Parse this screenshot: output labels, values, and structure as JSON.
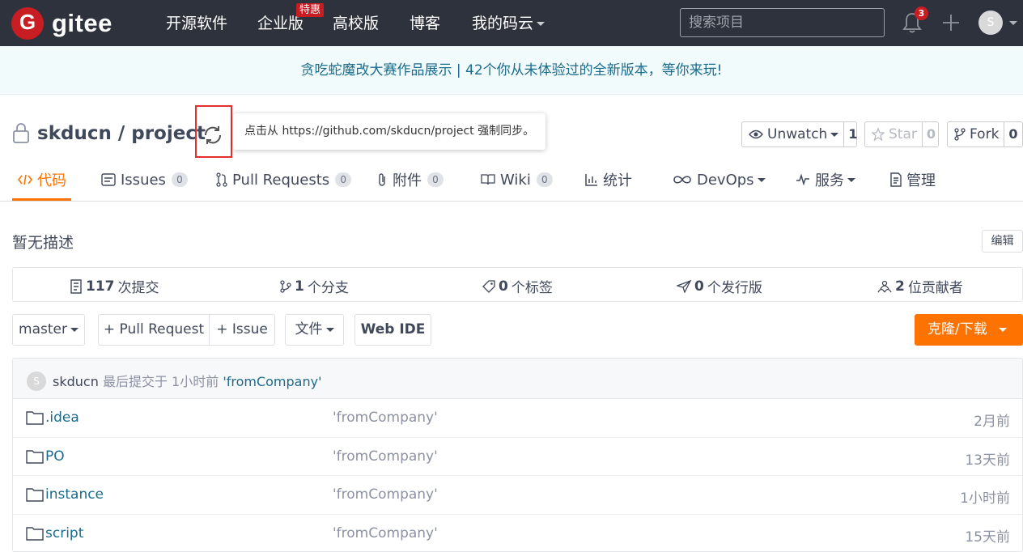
{
  "nav": {
    "logo_text": "gitee",
    "links": [
      "开源软件",
      "企业版",
      "高校版",
      "博客",
      "我的码云"
    ],
    "special_badge": "特惠",
    "search_placeholder": "搜索项目",
    "notification_count": "3",
    "avatar_letter": "S"
  },
  "banner": {
    "text": "贪吃蛇魔改大赛作品展示 | 42个你从未体验过的全新版本，等你来玩!"
  },
  "repo": {
    "title": "skducn / project",
    "sync_tooltip": "点击从 https://github.com/skducn/project 强制同步。",
    "watch_label": "Unwatch",
    "watch_count": "1",
    "star_label": "Star",
    "star_count": "0",
    "fork_label": "Fork",
    "fork_count": "0"
  },
  "tabs": [
    {
      "label": "代码",
      "icon": "code-icon"
    },
    {
      "label": "Issues",
      "count": "0",
      "icon": "issues-icon"
    },
    {
      "label": "Pull Requests",
      "count": "0",
      "icon": "pull-request-icon"
    },
    {
      "label": "附件",
      "count": "0",
      "icon": "paperclip-icon"
    },
    {
      "label": "Wiki",
      "count": "0",
      "icon": "book-icon"
    },
    {
      "label": "统计",
      "icon": "bar-chart-icon"
    },
    {
      "label": "DevOps",
      "icon": "infinity-icon"
    },
    {
      "label": "服务",
      "icon": "pulse-icon"
    },
    {
      "label": "管理",
      "icon": "document-icon"
    }
  ],
  "description": "暂无描述",
  "edit_label": "编辑",
  "stats": [
    {
      "value": "117",
      "label": "次提交"
    },
    {
      "value": "1",
      "label": "个分支"
    },
    {
      "value": "0",
      "label": "个标签"
    },
    {
      "value": "0",
      "label": "个发行版"
    },
    {
      "value": "2",
      "label": "位贡献者"
    }
  ],
  "toolbar": {
    "branch": "master",
    "pull_request": "+ Pull Request",
    "issue": "+ Issue",
    "file": "文件",
    "web_ide": "Web IDE",
    "clone": "克隆/下载"
  },
  "last_commit": {
    "avatar_letter": "S",
    "author": "skducn",
    "text": "最后提交于",
    "time": "1小时前",
    "message": "'fromCompany'"
  },
  "files": [
    {
      "name": ".idea",
      "message": "'fromCompany'",
      "time": "2月前"
    },
    {
      "name": "PO",
      "message": "'fromCompany'",
      "time": "13天前"
    },
    {
      "name": "instance",
      "message": "'fromCompany'",
      "time": "1小时前"
    },
    {
      "name": "script",
      "message": "'fromCompany'",
      "time": "15天前"
    }
  ],
  "colors": {
    "nav_bg": "#2e323c",
    "brand_red": "#c71d23",
    "accent_orange": "#fe7300",
    "link_blue": "#1a6b8c"
  }
}
